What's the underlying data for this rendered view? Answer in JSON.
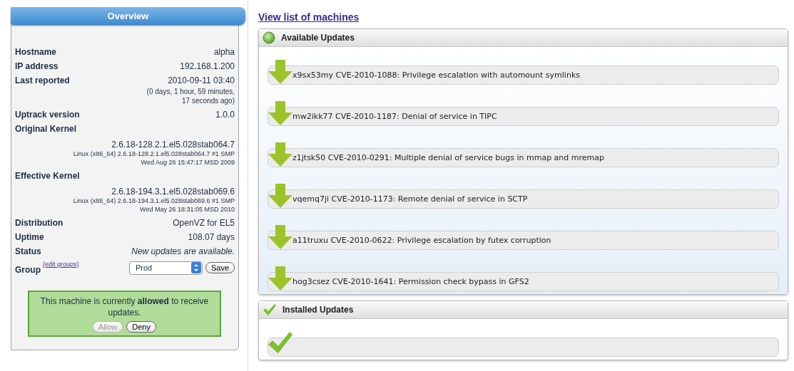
{
  "overview": {
    "title": "Overview",
    "fields": [
      {
        "kind": "simple",
        "label": "Hostname",
        "value": "alpha"
      },
      {
        "kind": "simple",
        "label": "IP address",
        "value": "192.168.1.200"
      },
      {
        "kind": "note",
        "label": "Last reported",
        "value": "2010-09-11 03:40",
        "note": "(0 days, 1 hour, 59 minutes, 17 seconds ago)"
      },
      {
        "kind": "simple",
        "label": "Uptrack version",
        "value": "1.0.0"
      },
      {
        "kind": "kernel",
        "label": "Original Kernel",
        "value": "2.6.18-128.2.1.el5.028stab064.7",
        "note": "Linux (x86_64) 2.6.18-128.2.1.el5.028stab064.7 #1 SMP Wed Aug 26 15:47:17 MSD 2009"
      },
      {
        "kind": "kernel",
        "label": "Effective Kernel",
        "value": "2.6.18-194.3.1.el5.028stab069.6",
        "note": "Linux (x86_64) 2.6.18-194.3.1.el5.028stab069.6 #1 SMP Wed May 26 18:31:05 MSD 2010"
      },
      {
        "kind": "simple",
        "label": "Distribution",
        "value": "OpenVZ for EL5"
      },
      {
        "kind": "simple",
        "label": "Uptime",
        "value": "108.07 days"
      },
      {
        "kind": "status",
        "label": "Status",
        "value": "New updates are available."
      }
    ],
    "group": {
      "label": "Group",
      "link": "(edit groups)",
      "value": "Prod",
      "save": "Save"
    },
    "notice": {
      "text": "This machine is currently **allowed** to receive updates.",
      "buttons": [
        {
          "label": "Allow",
          "disabled": true
        },
        {
          "label": "Deny",
          "disabled": false
        }
      ]
    }
  },
  "link": "View list of machines",
  "sections": [
    {
      "kind": "available",
      "title": "Available Updates",
      "items": [
        "x9sx53my CVE-2010-1088: Privilege escalation with automount symlinks",
        "mw2ikk77 CVE-2010-1187: Denial of service in TIPC",
        "z1jtsk50 CVE-2010-0291: Multiple denial of service bugs in mmap and mremap",
        "vqemq7ji CVE-2010-1173: Remote denial of service in SCTP",
        "a11truxu CVE-2010-0622: Privilege escalation by futex corruption",
        "hog3csez CVE-2010-1641: Permission check bypass in GFS2"
      ]
    },
    {
      "kind": "installed",
      "title": "Installed Updates"
    }
  ]
}
